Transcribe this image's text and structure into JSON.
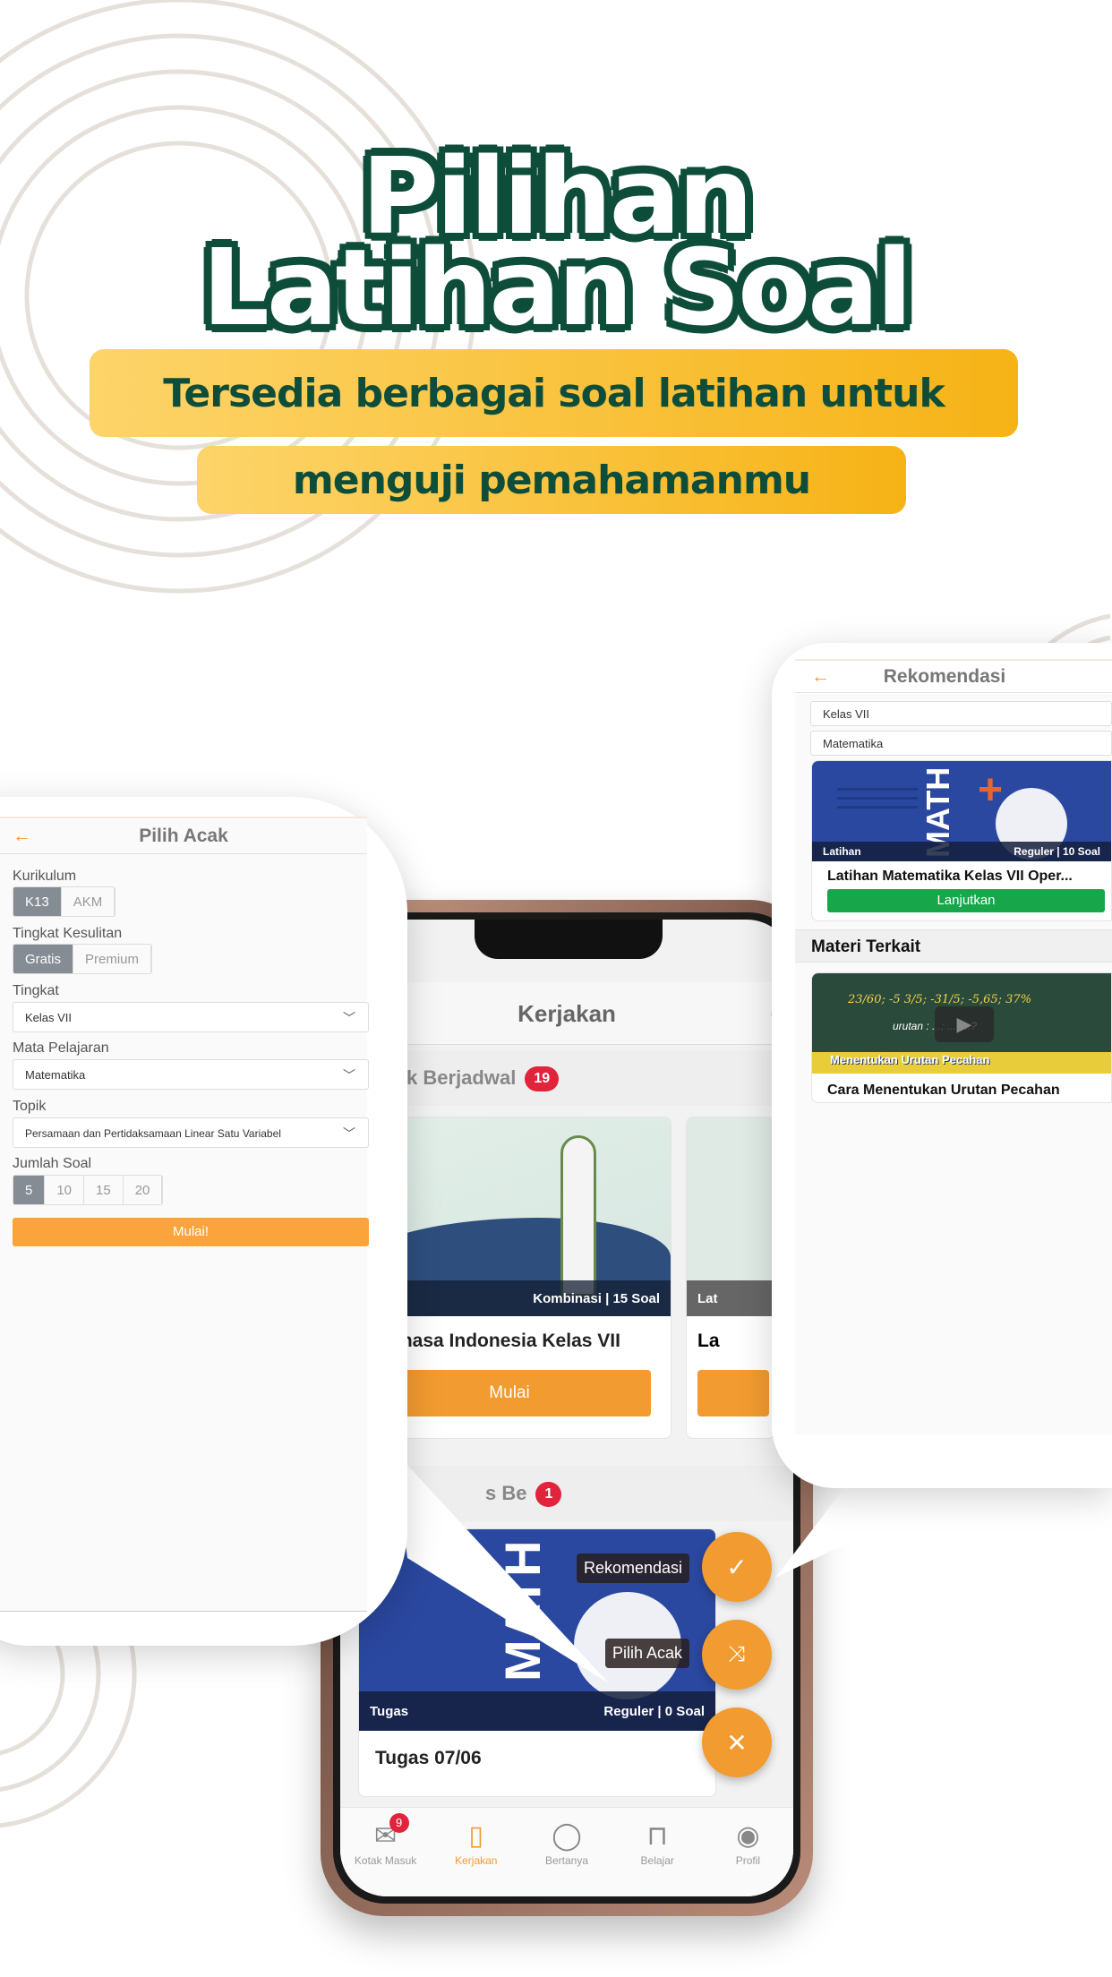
{
  "hero": {
    "title_line1": "Pilihan",
    "title_line2": "Latihan Soal",
    "subtitle_line1": "Tersedia berbagai soal latihan untuk",
    "subtitle_line2": "menguji pemahamanmu"
  },
  "colors": {
    "brand_green": "#0d4d3a",
    "accent_orange": "#f29b30",
    "banner_yellow": "#f6b316",
    "success_green": "#17a74a",
    "badge_red": "#e0243c"
  },
  "phone": {
    "header_title": "Kerjakan",
    "section1": {
      "title": "Tak Berjadwal",
      "count": "19"
    },
    "card1": {
      "tag_right": "Kombinasi | 15 Soal",
      "title": "Bahasa Indonesia Kelas VII",
      "button": "Mulai"
    },
    "card1_peek": {
      "tag": "Lat",
      "title": "La"
    },
    "section2": {
      "title": "s Be",
      "count": "1"
    },
    "card2": {
      "image_text": "MATH",
      "tag_left": "Tugas",
      "tag_right": "Reguler | 0 Soal",
      "title": "Tugas 07/06"
    },
    "fab_tooltips": {
      "recommend": "Rekomendasi",
      "random": "Pilih Acak"
    },
    "fab_icons": [
      "check-icon",
      "shuffle-icon",
      "close-icon"
    ],
    "nav": [
      {
        "label": "Kotak Masuk",
        "icon": "inbox-icon",
        "badge": "9"
      },
      {
        "label": "Kerjakan",
        "icon": "clipboard-icon",
        "active": true
      },
      {
        "label": "Bertanya",
        "icon": "chat-icon"
      },
      {
        "label": "Belajar",
        "icon": "book-icon"
      },
      {
        "label": "Profil",
        "icon": "profile-icon"
      }
    ]
  },
  "pilih_acak": {
    "title": "Pilih Acak",
    "kurikulum": {
      "label": "Kurikulum",
      "options": [
        "K13",
        "AKM"
      ],
      "selected": "K13"
    },
    "kesulitan": {
      "label": "Tingkat Kesulitan",
      "options": [
        "Gratis",
        "Premium"
      ],
      "selected": "Gratis"
    },
    "tingkat": {
      "label": "Tingkat",
      "value": "Kelas VII"
    },
    "mapel": {
      "label": "Mata Pelajaran",
      "value": "Matematika"
    },
    "topik": {
      "label": "Topik",
      "value": "Persamaan dan Pertidaksamaan Linear Satu Variabel"
    },
    "jumlah": {
      "label": "Jumlah Soal",
      "options": [
        "5",
        "10",
        "15",
        "20"
      ],
      "selected": "5"
    },
    "start_button": "Mulai!"
  },
  "rekomendasi": {
    "title": "Rekomendasi",
    "kelas": "Kelas VII",
    "mapel": "Matematika",
    "card": {
      "image_text": "MATH",
      "tag_left": "Latihan",
      "tag_right": "Reguler | 10 Soal",
      "title": "Latihan Matematika Kelas VII Oper...",
      "button": "Lanjutkan"
    },
    "related_title": "Materi Terkait",
    "video": {
      "formula": "23/60; -5 3/5; -31/5; -5,65; 37%",
      "formula_line2": "urutan : ...; ...; ...?",
      "banner": "Menentukan Urutan Pecahan",
      "caption": "Cara Menentukan Urutan Pecahan"
    }
  }
}
